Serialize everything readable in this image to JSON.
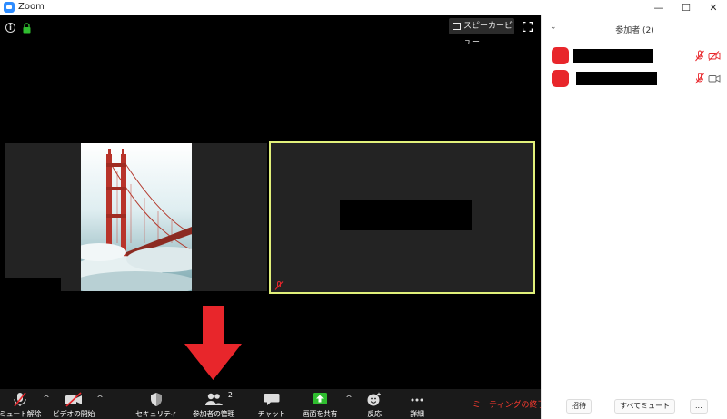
{
  "window": {
    "title": "Zoom",
    "minimize": "—",
    "maximize": "☐",
    "close": "✕"
  },
  "video": {
    "speaker_view_label": "スピーカービュー",
    "icons": [
      "info-icon",
      "lock-icon",
      "fullscreen-icon",
      "muted-mic-icon"
    ],
    "active_border_color": "#e1f07a"
  },
  "toolbar": {
    "mute": "ミュート解除",
    "video": "ビデオの開始",
    "security": "セキュリティ",
    "participants": "参加者の管理",
    "participants_count": "2",
    "chat": "チャット",
    "share": "画面を共有",
    "reactions": "反応",
    "more": "詳細",
    "end": "ミーティングの終了",
    "caret": "^"
  },
  "panel": {
    "collapse": "⌄",
    "title": "参加者 (2)",
    "participants": [
      {
        "avatar_color": "#e8262b",
        "muted": true,
        "video_off": true
      },
      {
        "avatar_color": "#e8262b",
        "muted": true,
        "video_off": false
      }
    ],
    "invite": "招待",
    "mute_all": "すべてミュート",
    "more": "..."
  },
  "colors": {
    "end_red": "#ff3b30",
    "share_green": "#2fbd2f",
    "arrow_red": "#e8262b"
  }
}
